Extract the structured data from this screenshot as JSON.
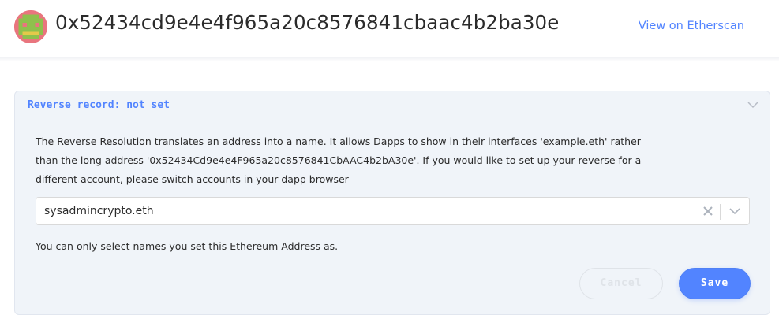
{
  "header": {
    "address": "0x52434cd9e4e4f965a20c8576841cbaac4b2ba30e",
    "etherscan_link": "View on Etherscan"
  },
  "reverse_record": {
    "title": "Reverse record: not set",
    "description": "The Reverse Resolution translates an address into a name. It allows Dapps to show in their interfaces 'example.eth' rather than the long address '0x52434Cd9e4e4F965a20c8576841CbAAC4b2bA30e'. If you would like to set up your reverse for a different account, please switch accounts in your dapp browser",
    "selected_name": "sysadmincrypto.eth",
    "hint": "You can only select names you set this Ethereum Address as.",
    "cancel_label": "Cancel",
    "save_label": "Save"
  },
  "colors": {
    "accent": "#5284ff",
    "panel_background": "#f0f4f9",
    "text": "#2b2b2b",
    "disabled": "#dfe3e8"
  },
  "icons": {
    "avatar": "blockie-avatar",
    "panel_toggle": "chevron-down-icon",
    "clear": "close-icon",
    "dropdown": "chevron-down-icon"
  }
}
